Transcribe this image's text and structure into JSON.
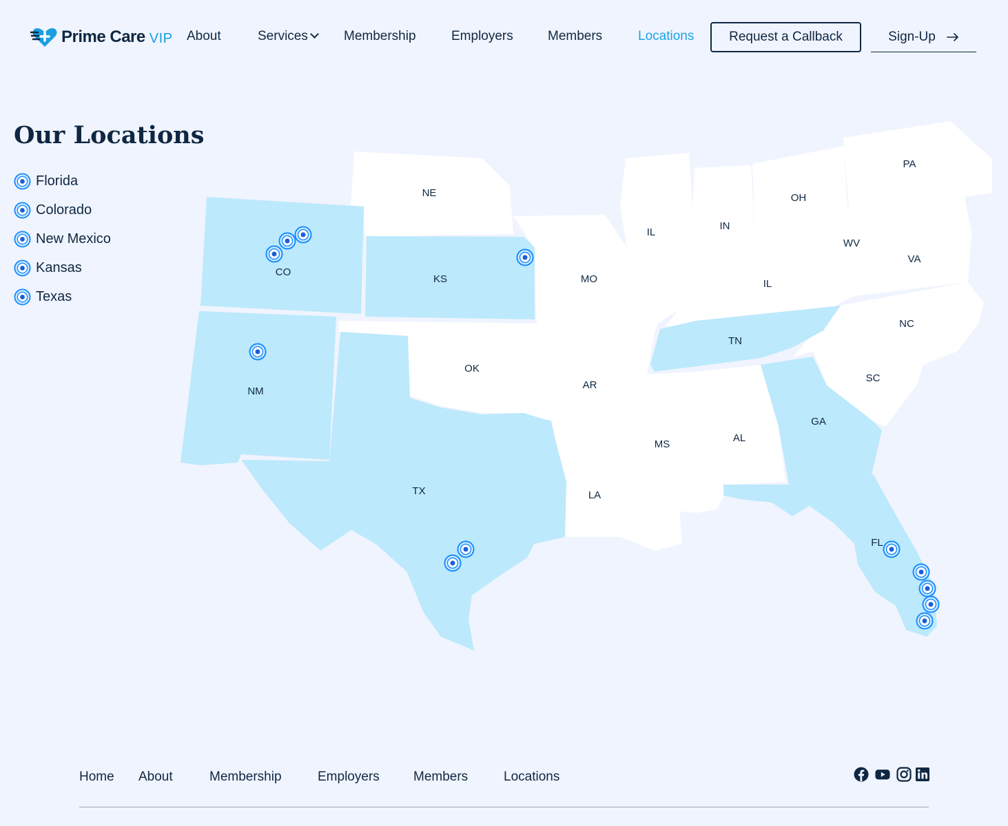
{
  "brand": {
    "name": "Prime Care",
    "suffix": "VIP",
    "color": "#1a9fe0"
  },
  "nav": {
    "about": "About",
    "services": "Services",
    "membership": "Membership",
    "employers": "Employers",
    "members": "Members",
    "locations": "Locations",
    "callback": "Request a Callback",
    "signup": "Sign-Up"
  },
  "page": {
    "title": "Our Locations"
  },
  "locations": [
    "Florida",
    "Colorado",
    "New Mexico",
    "Kansas",
    "Texas"
  ],
  "map": {
    "highlight_color": "#bce9fc",
    "base_color": "#ffffff",
    "pin_color": "#1a8cff",
    "states": {
      "NE": "NE",
      "PA": "PA",
      "OH": "OH",
      "IL": "IL",
      "IN": "IN",
      "WV": "WV",
      "VA": "VA",
      "CO": "CO",
      "KS": "KS",
      "MO": "MO",
      "KY": "IL",
      "NC": "NC",
      "TN": "TN",
      "NM": "NM",
      "OK": "OK",
      "AR": "AR",
      "SC": "SC",
      "GA": "GA",
      "AL": "AL",
      "MS": "MS",
      "TX": "TX",
      "LA": "LA",
      "FL": "FL"
    },
    "highlighted": [
      "CO",
      "KS",
      "NM",
      "TX",
      "TN",
      "GA",
      "FL"
    ]
  },
  "footer": {
    "home": "Home",
    "about": "About",
    "membership": "Membership",
    "employers": "Employers",
    "members": "Members",
    "locations": "Locations",
    "social": [
      "facebook-icon",
      "youtube-icon",
      "instagram-icon",
      "linkedin-icon"
    ]
  }
}
